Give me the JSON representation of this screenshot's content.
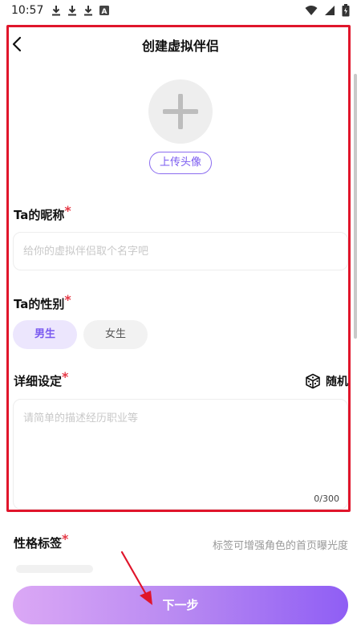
{
  "status_bar": {
    "time": "10:57",
    "letter_icon": "A"
  },
  "header": {
    "title": "创建虚拟伴侣"
  },
  "avatar": {
    "upload_label": "上传头像"
  },
  "nickname": {
    "label": "Ta的昵称",
    "required_mark": "*",
    "placeholder": "给你的虚拟伴侣取个名字吧",
    "value": ""
  },
  "gender": {
    "label": "Ta的性别",
    "required_mark": "*",
    "options": [
      "男生",
      "女生"
    ],
    "selected": "男生"
  },
  "details": {
    "label": "详细设定",
    "required_mark": "*",
    "random_label": "随机",
    "placeholder": "请简单的描述经历职业等",
    "value": "",
    "count": "0/300"
  },
  "tags": {
    "label": "性格标签",
    "required_mark": "*",
    "hint": "标签可增强角色的首页曝光度"
  },
  "footer": {
    "next_label": "下一步"
  },
  "colors": {
    "accent": "#7a5af0",
    "highlight_border": "#e0152b",
    "required": "#e63946"
  }
}
